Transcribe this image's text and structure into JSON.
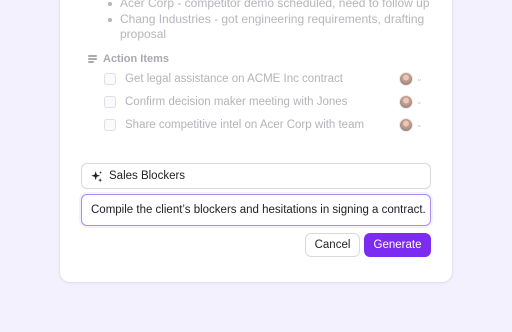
{
  "notes": {
    "bullets": [
      "Acer Corp - competitor demo scheduled, need to follow up",
      "Chang Industries - got engineering requirements, drafting proposal"
    ]
  },
  "action_items": {
    "heading": "Action Items",
    "heading_icon": "lines-icon",
    "items": [
      {
        "label": "Get legal assistance on ACME Inc contract"
      },
      {
        "label": "Confirm decision maker meeting with Jones"
      },
      {
        "label": "Share competitive intel on Acer Corp with team"
      }
    ]
  },
  "prompt": {
    "title": "Sales Blockers",
    "title_icon": "sparkle-icon",
    "text": "Compile the client’s blockers and hesitations in signing a contract."
  },
  "buttons": {
    "cancel": "Cancel",
    "generate": "Generate"
  },
  "colors": {
    "accent": "#7b2cf0",
    "focus_border": "#a88ef2",
    "background": "#f3f1fd"
  }
}
